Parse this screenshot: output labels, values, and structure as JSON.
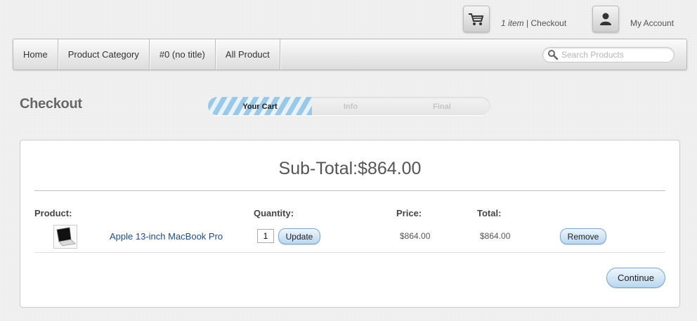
{
  "header": {
    "cart_count": "1 item",
    "cart_separator": " | ",
    "cart_checkout": "Checkout",
    "account_label": "My Account"
  },
  "nav": {
    "items": [
      "Home",
      "Product Category",
      "#0 (no title)",
      "All Product"
    ],
    "search_placeholder": "Search Products"
  },
  "page": {
    "title": "Checkout",
    "steps": [
      {
        "label": "Your Cart",
        "active": true
      },
      {
        "label": "Info",
        "active": false
      },
      {
        "label": "Final",
        "active": false
      }
    ]
  },
  "cart": {
    "subtotal_label": "Sub-Total:",
    "subtotal_value": "$864.00",
    "columns": {
      "product": "Product:",
      "quantity": "Quantity:",
      "price": "Price:",
      "total": "Total:"
    },
    "items": [
      {
        "name": "Apple 13-inch MacBook Pro",
        "quantity": "1",
        "price": "$864.00",
        "total": "$864.00",
        "thumbnail_icon": "laptop-icon"
      }
    ],
    "update_label": "Update",
    "remove_label": "Remove",
    "continue_label": "Continue"
  },
  "colors": {
    "link": "#1d4c8a",
    "button_top": "#eef6fd",
    "button_bottom": "#b9d7ef",
    "progress_stripe": "#9cc8e8"
  },
  "icons": {
    "cart": "shopping-cart-icon",
    "account": "user-icon",
    "search": "magnifier-icon"
  }
}
